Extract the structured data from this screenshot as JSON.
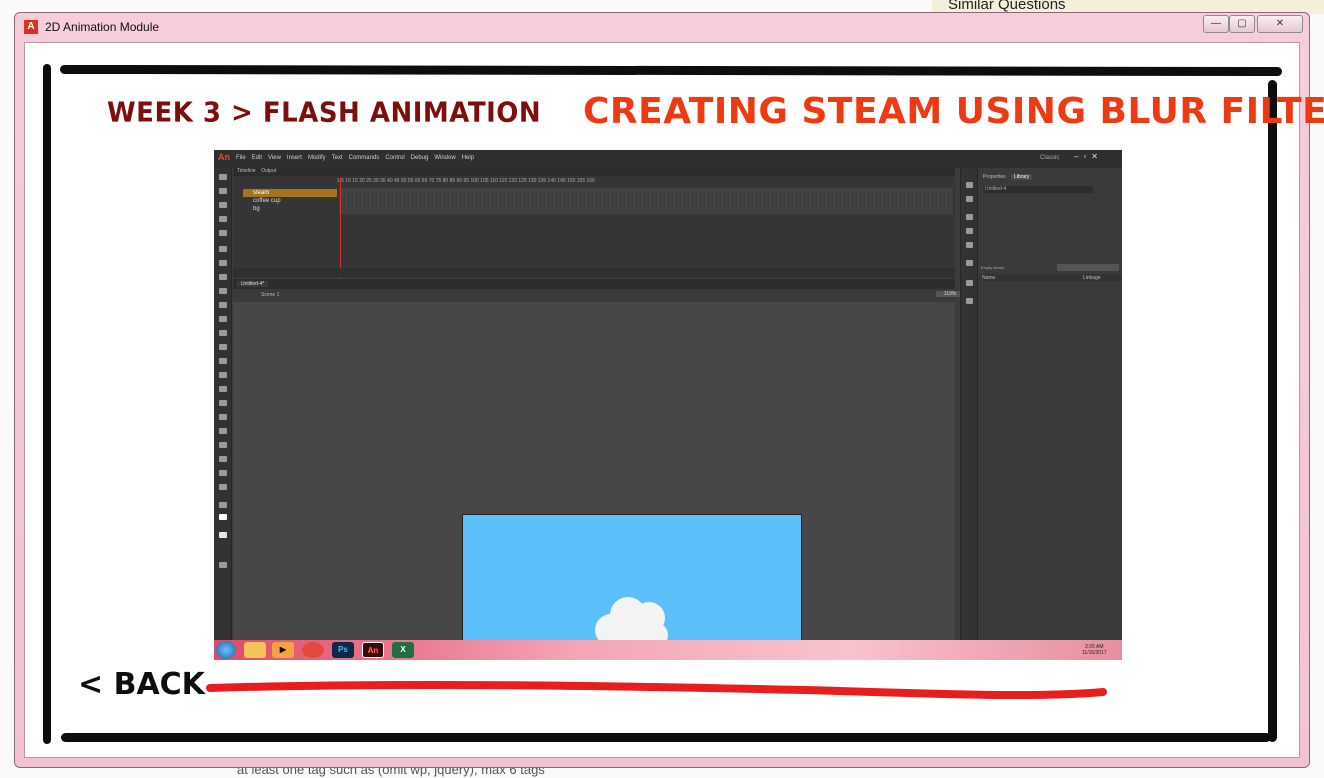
{
  "background": {
    "similar_header": "Similar Questions",
    "bottom_text": "at least one tag such as (omit wp, jquery), max 6 tags"
  },
  "window": {
    "title": "2D Animation Module",
    "app_icon_glyph": "A",
    "controls": {
      "minimize": "—",
      "maximize": "▢",
      "close": "✕"
    }
  },
  "header": {
    "breadcrumb": "WEEK 3 > FLASH ANIMATION",
    "lesson_title": "CREATING STEAM USING BLUR FILTER"
  },
  "footer": {
    "back_label": "< BACK"
  },
  "animate_ui": {
    "menu": [
      "File",
      "Edit",
      "View",
      "Insert",
      "Modify",
      "Text",
      "Commands",
      "Control",
      "Debug",
      "Window",
      "Help"
    ],
    "workspace": "Classic",
    "timeline_tabs": [
      "Timeline",
      "Output"
    ],
    "ruler": "1    5    10    15    20    25    30    35    40    45    50    55    60    65    70    75    80    85    90    95    100    105    110    115    120    125    130    135    140    145    150    155    160",
    "layers": [
      "steam",
      "coffee cup",
      "bg"
    ],
    "document_tab": "Untitled-4*",
    "scene": "Scene 1",
    "zoom": "119%",
    "panel_tabs": [
      "Properties",
      "Library"
    ],
    "library_doc": "Untitled-4",
    "library_empty": "Empty library",
    "library_columns": {
      "name": "Name",
      "linkage": "Linkage"
    }
  },
  "stage_colors": {
    "sky": "#5bc0fa",
    "table": "#6b3835",
    "cup": "#f0f0ee",
    "coffee": "#5a2a10",
    "steam": "#f3f3f3"
  },
  "taskbar": {
    "clock_time": "2:26 AM",
    "clock_date": "11/16/2017",
    "apps": [
      "windows-start",
      "file-explorer",
      "media-player",
      "chrome",
      "photoshop",
      "animate",
      "excel"
    ]
  },
  "accent_colors": {
    "breadcrumb": "#7e0d0d",
    "title": "#ee3a12",
    "underline": "#e81e1e"
  }
}
